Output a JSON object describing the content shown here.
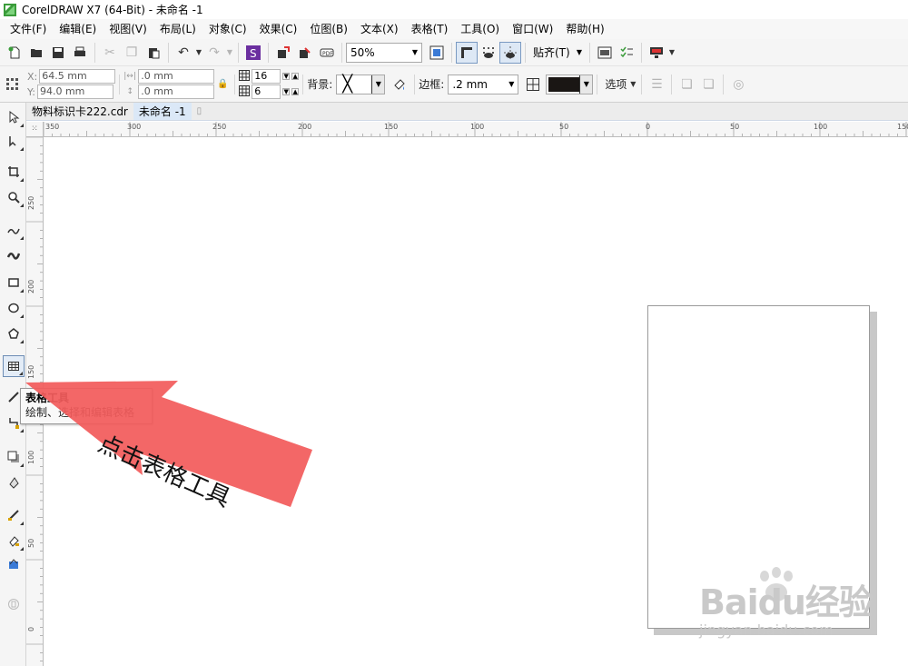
{
  "window": {
    "title": "CorelDRAW X7 (64-Bit) - 未命名 -1"
  },
  "menu": [
    "文件(F)",
    "编辑(E)",
    "视图(V)",
    "布局(L)",
    "对象(C)",
    "效果(C)",
    "位图(B)",
    "文本(X)",
    "表格(T)",
    "工具(O)",
    "窗口(W)",
    "帮助(H)"
  ],
  "toolbar": {
    "zoom": "50%",
    "snap_label": "贴齐(T)"
  },
  "property_bar": {
    "x_label": "X:",
    "x_value": "64.5 mm",
    "y_label": "Y:",
    "y_value": "94.0 mm",
    "w_value": ".0 mm",
    "h_value": ".0 mm",
    "rows_value": "16",
    "cols_value": "6",
    "background_label": "背景:",
    "border_label": "边框:",
    "border_width": ".2 mm",
    "border_color": "#1a1614",
    "options_label": "选项"
  },
  "document_tabs": [
    {
      "label": "物料标识卡222.cdr",
      "active": false
    },
    {
      "label": "未命名 -1",
      "active": true
    }
  ],
  "ruler_top_labels": [
    "350",
    "300",
    "250",
    "200",
    "150",
    "100",
    "50",
    "0",
    "50",
    "100",
    "150"
  ],
  "ruler_left_labels": [
    "250",
    "200",
    "150",
    "100",
    "50",
    "0"
  ],
  "tooltip": {
    "title": "表格工具",
    "description": "绘制、选择和编辑表格"
  },
  "annotation": {
    "text": "点击表格工具",
    "color": "#f25b5b"
  },
  "watermark": {
    "logo": "Baidu经验",
    "url": "jingyan.baidu.com"
  }
}
